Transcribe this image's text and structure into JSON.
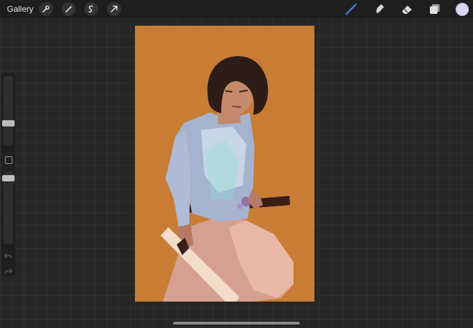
{
  "topbar": {
    "gallery_label": "Gallery",
    "left_tools": [
      "wrench-icon",
      "magic-wand-icon",
      "selection-icon",
      "transform-icon"
    ],
    "right_tools": [
      "brush-icon",
      "smudge-icon",
      "eraser-icon",
      "layers-icon"
    ],
    "active_tool": "brush-icon",
    "active_color": "#dcd5f2",
    "accent_color": "#3a7bd5"
  },
  "sidebar": {
    "controls": [
      "brush-size-slider",
      "modify-button",
      "opacity-slider",
      "undo-icon",
      "redo-icon"
    ]
  },
  "canvas": {
    "background_color": "#c87c34"
  }
}
